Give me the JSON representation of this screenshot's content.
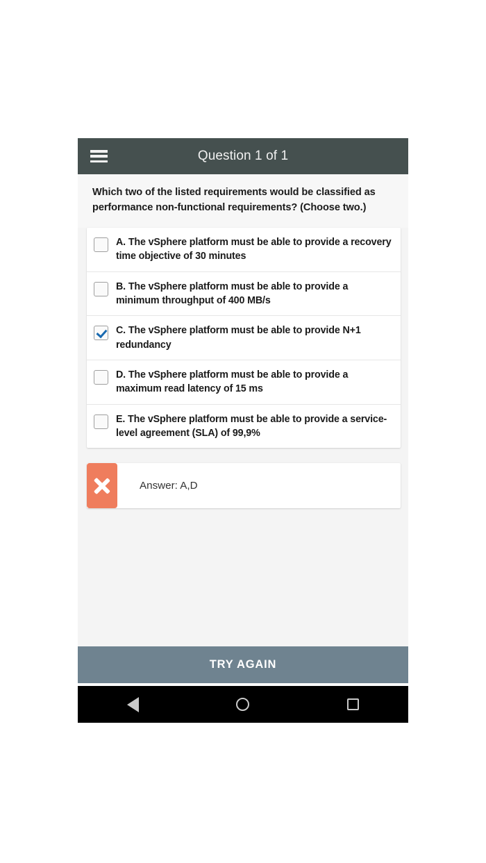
{
  "app": {
    "header": {
      "menu_icon": "hamburger-menu-icon",
      "title": "Question 1 of 1"
    },
    "question": {
      "text": "Which two of the listed requirements would be classified as performance non-functional requirements? (Choose two.)"
    },
    "options": [
      {
        "id": "A",
        "label": "A. The vSphere platform must be able to provide a recovery time objective of 30 minutes",
        "checked": false
      },
      {
        "id": "B",
        "label": "B. The vSphere platform must be able to provide a minimum throughput of 400 MB/s",
        "checked": false
      },
      {
        "id": "C",
        "label": "C. The vSphere platform must be able to provide N+1 redundancy",
        "checked": true
      },
      {
        "id": "D",
        "label": "D. The vSphere platform must be able to provide a maximum read latency of 15 ms",
        "checked": false
      },
      {
        "id": "E",
        "label": "E. The vSphere platform must be able to provide a service-level agreement (SLA) of 99,9%",
        "checked": false
      }
    ],
    "result": {
      "status_icon": "x-mark-icon",
      "status": "incorrect",
      "answer_text": "Answer: A,D"
    },
    "footer": {
      "try_again_label": "TRY AGAIN"
    },
    "recorder": {
      "record_icon": "record-dot-icon",
      "restart_icon": "record-restart-icon"
    },
    "navbar": {
      "back_icon": "back-triangle-icon",
      "home_icon": "home-circle-icon",
      "recents_icon": "recents-square-icon"
    },
    "colors": {
      "appbar": "#45504f",
      "checkbox_checked": "#1869b0",
      "status_badge": "#ef7d5d",
      "try_again": "#6f8390",
      "record_dot": "#e8341c"
    }
  }
}
